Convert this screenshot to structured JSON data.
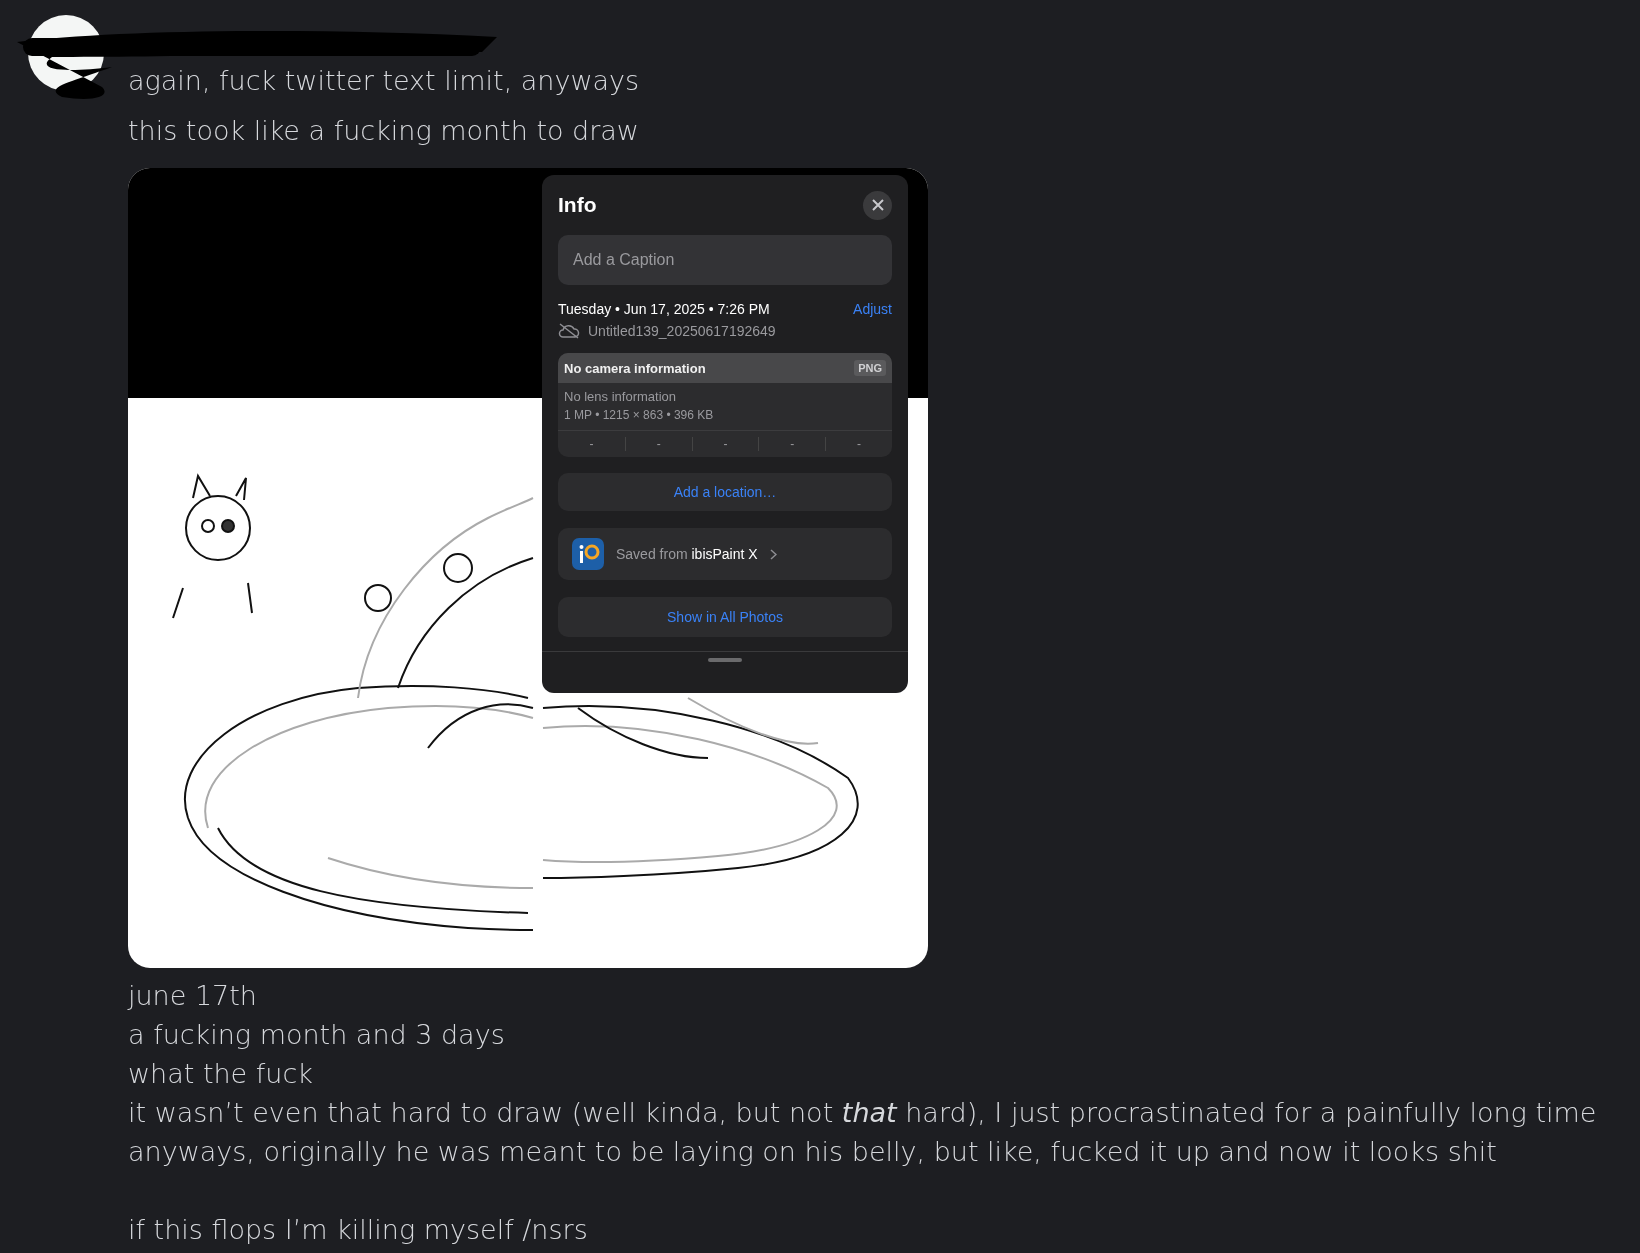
{
  "message": {
    "lines_before": [
      "again, fuck twitter text limit, anyways",
      "this took like a fucking month to draw"
    ],
    "attachment": {
      "info_panel": {
        "title": "Info",
        "caption": {
          "placeholder": "Add a Caption"
        },
        "date": "Tuesday • Jun 17, 2025 • 7:26 PM",
        "adjust": "Adjust",
        "filename": "Untitled139_20250617192649",
        "camera": "No camera information",
        "format": "PNG",
        "lens": "No lens information",
        "specs": "1 MP • 1215 × 863 • 396 KB",
        "exif": [
          "-",
          "-",
          "-",
          "-",
          "-"
        ],
        "location": "Add a location…",
        "saved_from": "Saved from **ibisPaint X**",
        "show_all": "Show in All Photos"
      }
    },
    "lines_after": [
      "june 17th",
      "a fucking month and 3 days",
      "what the fuck",
      "it wasn’t even that hard to draw (well kinda, but not *that* hard), I just procrastinated for a painfully long time",
      "anyways, originally he was meant to be laying on his belly, but like, fucked it up and now it looks shit"
    ],
    "closing_line": "if this flops I’m killing myself /nsrs"
  }
}
